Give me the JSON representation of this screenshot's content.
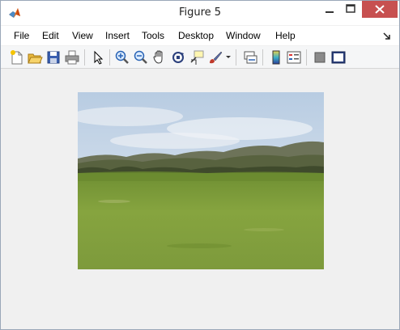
{
  "window": {
    "title": "Figure 5",
    "controls": {
      "minimize": "minimize",
      "maximize": "maximize",
      "close": "close"
    }
  },
  "menubar": {
    "items": [
      {
        "label": "File"
      },
      {
        "label": "Edit"
      },
      {
        "label": "View"
      },
      {
        "label": "Insert"
      },
      {
        "label": "Tools"
      },
      {
        "label": "Desktop"
      },
      {
        "label": "Window"
      },
      {
        "label": "Help"
      }
    ]
  },
  "toolbar": {
    "buttons": [
      "new-figure-icon",
      "open-file-icon",
      "save-icon",
      "print-icon",
      "edit-plot-arrow-icon",
      "zoom-in-icon",
      "zoom-out-icon",
      "pan-hand-icon",
      "rotate-3d-icon",
      "data-cursor-icon",
      "brush-icon",
      "brush-dropdown-icon",
      "link-plot-icon",
      "insert-colorbar-icon",
      "insert-legend-icon",
      "hide-plot-tools-icon",
      "show-plot-tools-icon"
    ]
  },
  "figure": {
    "image_description_colors": {
      "sky": "#c8d8ea",
      "hills": "#6f7a5a",
      "grass": "#7c9a3a"
    }
  }
}
